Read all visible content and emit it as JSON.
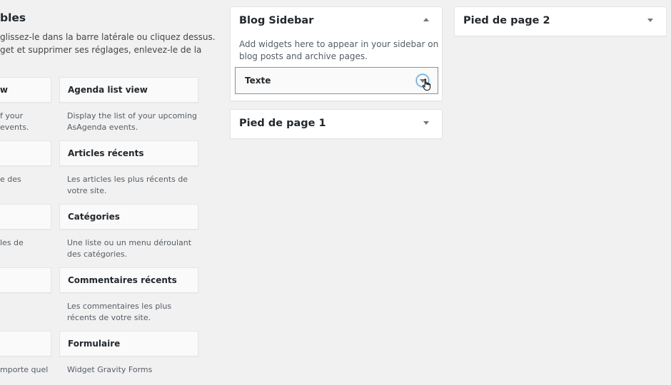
{
  "available": {
    "title": "bles",
    "desc_lines": [
      "glissez-le dans la barre latérale ou cliquez dessus.",
      "get et supprimer ses réglages, enlevez-le de la"
    ],
    "left_column": [
      {
        "title": "iew",
        "desc_lines": [
          "f your",
          "events."
        ]
      },
      {
        "title": "",
        "desc_lines": [
          "e des"
        ]
      },
      {
        "title": "",
        "desc_lines": [
          "les de"
        ]
      },
      {
        "title": "",
        "desc_lines": []
      },
      {
        "title": "",
        "desc_lines": [
          "mporte quel"
        ]
      }
    ],
    "right_column": [
      {
        "title": "Agenda list view",
        "desc_lines": [
          "Display the list of your upcoming",
          "AsAgenda events."
        ]
      },
      {
        "title": "Articles récents",
        "desc_lines": [
          "Les articles les plus récents de",
          "votre site."
        ]
      },
      {
        "title": "Catégories",
        "desc_lines": [
          "Une liste ou un menu déroulant",
          "des catégories."
        ]
      },
      {
        "title": "Commentaires récents",
        "desc_lines": [
          "Les commentaires les plus",
          "récents de votre site."
        ]
      },
      {
        "title": "Formulaire",
        "desc_lines": [
          "Widget Gravity Forms"
        ]
      }
    ]
  },
  "sidebars": {
    "blog": {
      "name": "Blog Sidebar",
      "desc_lines": [
        "Add widgets here to appear in your sidebar on",
        "blog posts and archive pages."
      ],
      "widget": {
        "title": "Texte"
      }
    },
    "footer1": {
      "name": "Pied de page 1"
    },
    "footer2": {
      "name": "Pied de page 2"
    }
  },
  "icons": {
    "collapse": "arrow-up-icon",
    "expand": "arrow-down-icon",
    "cursor": "hand-pointer-icon"
  },
  "colors": {
    "background": "#f1f1f1",
    "focus": "#5b9dd9",
    "text": "#23282d"
  }
}
